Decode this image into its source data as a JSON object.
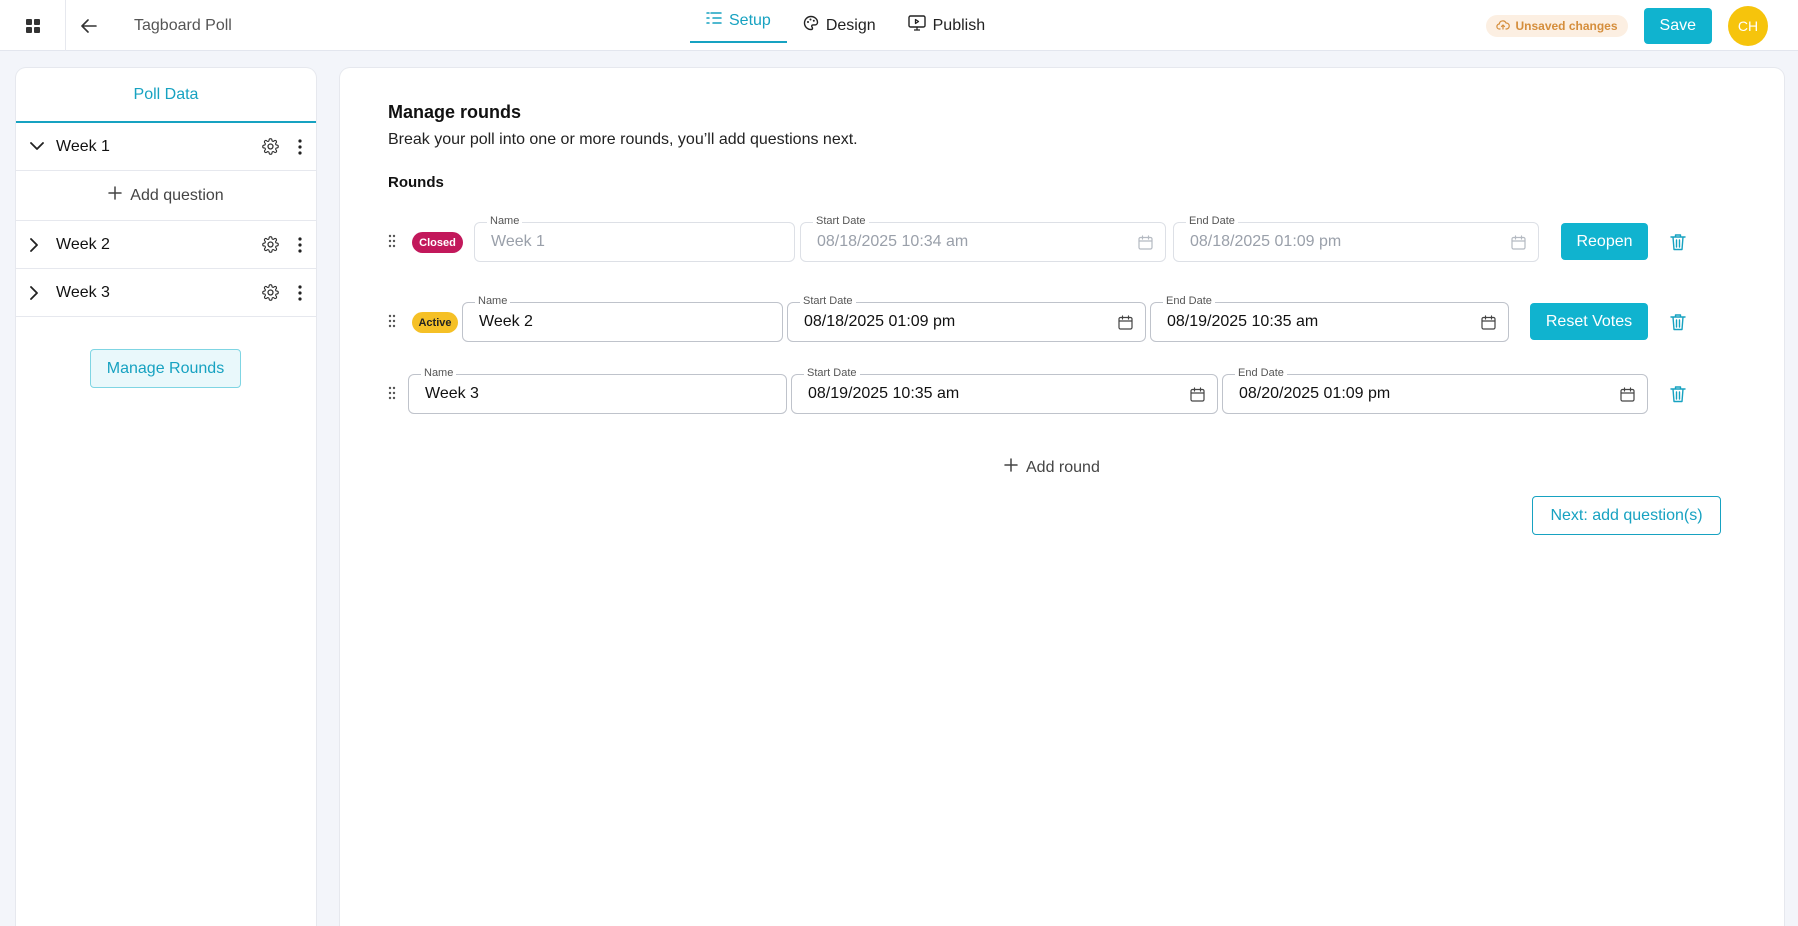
{
  "topbar": {
    "title": "Tagboard Poll",
    "tabs": [
      {
        "label": "Setup",
        "icon": "list-icon",
        "active": true
      },
      {
        "label": "Design",
        "icon": "palette-icon",
        "active": false
      },
      {
        "label": "Publish",
        "icon": "monitor-icon",
        "active": false
      }
    ],
    "unsaved_label": "Unsaved changes",
    "save_label": "Save",
    "avatar_initials": "CH"
  },
  "sidebar": {
    "heading": "Poll Data",
    "items": [
      {
        "label": "Week 1",
        "expanded": true
      },
      {
        "label": "Week 2",
        "expanded": false
      },
      {
        "label": "Week 3",
        "expanded": false
      }
    ],
    "add_question_label": "Add question",
    "manage_rounds_label": "Manage Rounds"
  },
  "main": {
    "title": "Manage rounds",
    "subtitle": "Break your poll into one or more rounds, you’ll add questions next.",
    "rounds_heading": "Rounds",
    "field_labels": {
      "name": "Name",
      "start": "Start Date",
      "end": "End Date"
    },
    "rounds": [
      {
        "status": "Closed",
        "name": "Week 1",
        "start": "08/18/2025 10:34 am",
        "end": "08/18/2025 01:09 pm",
        "action": "Reopen"
      },
      {
        "status": "Active",
        "name": "Week 2",
        "start": "08/18/2025 01:09 pm",
        "end": "08/19/2025 10:35 am",
        "action": "Reset Votes"
      },
      {
        "status": "",
        "name": "Week 3",
        "start": "08/19/2025 10:35 am",
        "end": "08/20/2025 01:09 pm",
        "action": ""
      }
    ],
    "add_round_label": "Add round",
    "next_label": "Next: add question(s)"
  },
  "colors": {
    "accent": "#10b3cf",
    "closed": "#c2185b",
    "active": "#f5c026",
    "avatar": "#f6c40c"
  }
}
